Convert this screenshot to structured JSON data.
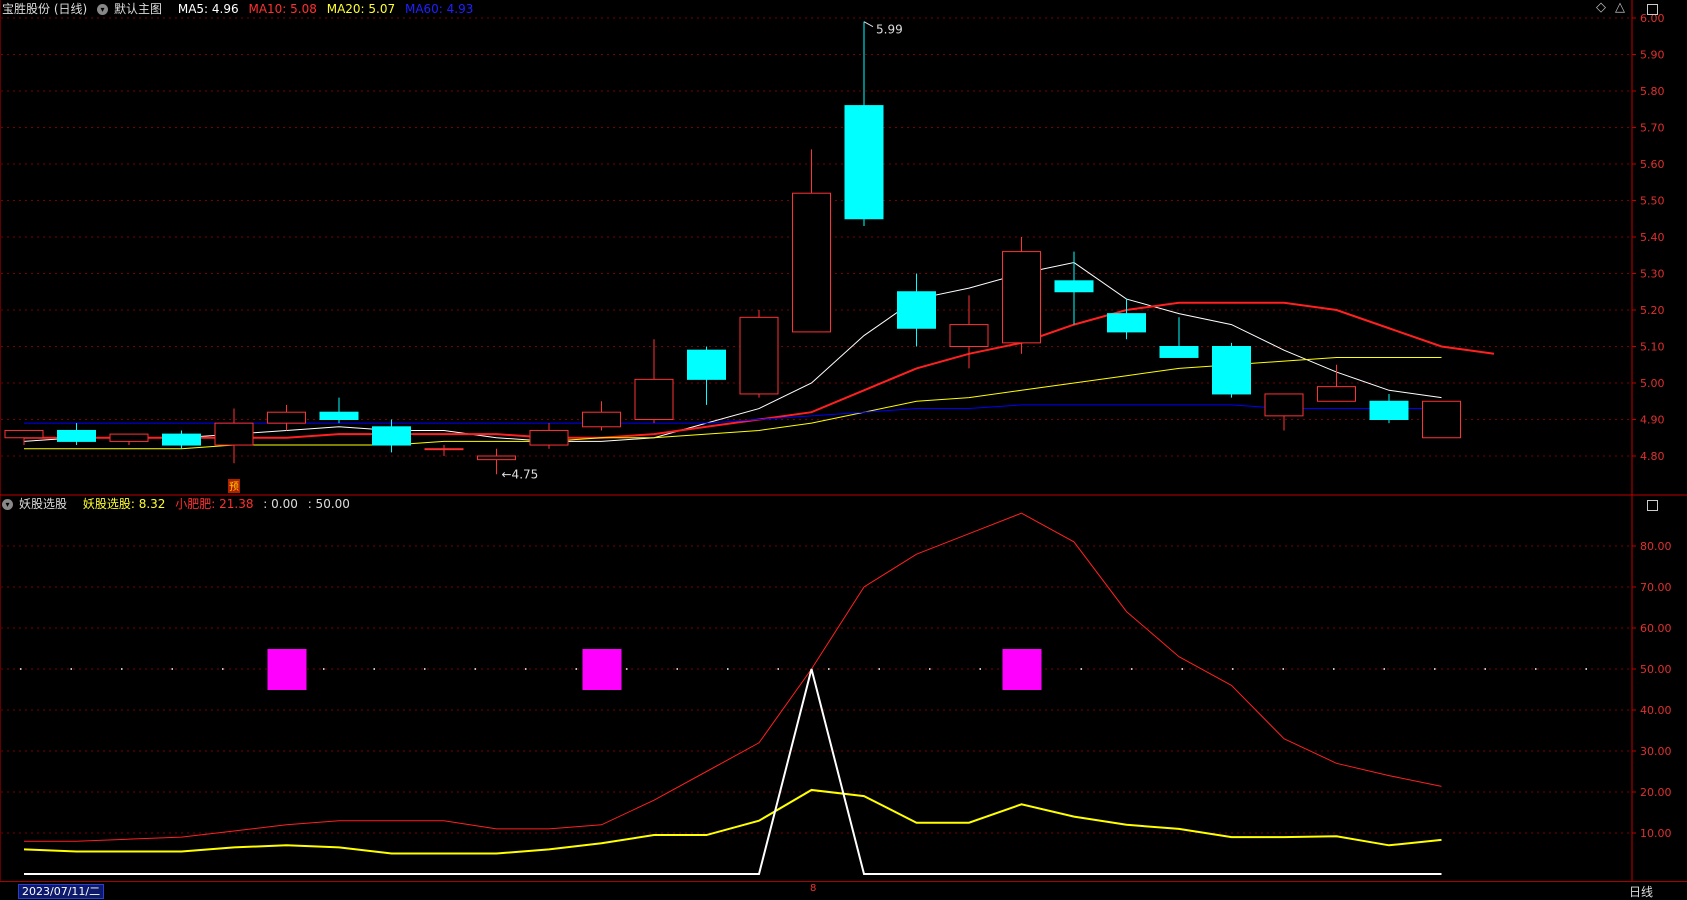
{
  "header": {
    "stock_name": "宝胜股份 (日线)",
    "template": "默认主图",
    "ma5_label": "MA5: 4.96",
    "ma10_label": "MA10: 5.08",
    "ma20_label": "MA20: 5.07",
    "ma60_label": "MA60: 4.93"
  },
  "indicator_header": {
    "name": "妖股选股",
    "yg_label": "妖股选股: 8.32",
    "xfp_label": "小肥肥: 21.38",
    "zero_label": ": 0.00",
    "fifty_label": ": 50.00"
  },
  "footer": {
    "date": "2023/07/11/二",
    "period": "日线",
    "cursor_label": "8"
  },
  "colors": {
    "up": "#ff3232",
    "down": "#00ffff",
    "ma5": "#ffffff",
    "ma10": "#ff2020",
    "ma20": "#ffff00",
    "ma60": "#0000ff",
    "magenta": "#ff00ff",
    "axis": "#c00000"
  },
  "chart_data": [
    {
      "type": "candlestick",
      "title": "宝胜股份 (日线)",
      "y_ticks": [
        "6.00",
        "5.90",
        "5.80",
        "5.70",
        "5.60",
        "5.50",
        "5.40",
        "5.30",
        "5.20",
        "5.10",
        "5.00",
        "4.90",
        "4.80"
      ],
      "ylim": [
        4.75,
        6.0
      ],
      "annotations": [
        {
          "text": "5.99",
          "note": "high"
        },
        {
          "text": "←4.75",
          "note": "low"
        }
      ],
      "marker_text": "预",
      "candles": [
        {
          "o": 4.85,
          "h": 4.87,
          "l": 4.83,
          "c": 4.87
        },
        {
          "o": 4.87,
          "h": 4.89,
          "l": 4.83,
          "c": 4.84
        },
        {
          "o": 4.84,
          "h": 4.86,
          "l": 4.83,
          "c": 4.86
        },
        {
          "o": 4.86,
          "h": 4.87,
          "l": 4.82,
          "c": 4.83
        },
        {
          "o": 4.83,
          "h": 4.93,
          "l": 4.78,
          "c": 4.89
        },
        {
          "o": 4.89,
          "h": 4.94,
          "l": 4.87,
          "c": 4.92
        },
        {
          "o": 4.92,
          "h": 4.96,
          "l": 4.89,
          "c": 4.9
        },
        {
          "o": 4.88,
          "h": 4.9,
          "l": 4.81,
          "c": 4.83
        },
        {
          "o": 4.82,
          "h": 4.83,
          "l": 4.8,
          "c": 4.82
        },
        {
          "o": 4.79,
          "h": 4.82,
          "l": 4.75,
          "c": 4.8
        },
        {
          "o": 4.83,
          "h": 4.89,
          "l": 4.82,
          "c": 4.87
        },
        {
          "o": 4.88,
          "h": 4.95,
          "l": 4.87,
          "c": 4.92
        },
        {
          "o": 4.9,
          "h": 5.12,
          "l": 4.89,
          "c": 5.01
        },
        {
          "o": 5.09,
          "h": 5.1,
          "l": 4.94,
          "c": 5.01
        },
        {
          "o": 4.97,
          "h": 5.2,
          "l": 4.96,
          "c": 5.18
        },
        {
          "o": 5.14,
          "h": 5.64,
          "l": 5.14,
          "c": 5.52
        },
        {
          "o": 5.76,
          "h": 5.99,
          "l": 5.43,
          "c": 5.45
        },
        {
          "o": 5.25,
          "h": 5.3,
          "l": 5.1,
          "c": 5.15
        },
        {
          "o": 5.1,
          "h": 5.24,
          "l": 5.04,
          "c": 5.16
        },
        {
          "o": 5.11,
          "h": 5.4,
          "l": 5.08,
          "c": 5.36
        },
        {
          "o": 5.28,
          "h": 5.36,
          "l": 5.16,
          "c": 5.25
        },
        {
          "o": 5.19,
          "h": 5.23,
          "l": 5.12,
          "c": 5.14
        },
        {
          "o": 5.1,
          "h": 5.18,
          "l": 5.07,
          "c": 5.07
        },
        {
          "o": 5.1,
          "h": 5.11,
          "l": 4.96,
          "c": 4.97
        },
        {
          "o": 4.91,
          "h": 4.97,
          "l": 4.87,
          "c": 4.97
        },
        {
          "o": 4.95,
          "h": 5.05,
          "l": 4.95,
          "c": 4.99
        },
        {
          "o": 4.95,
          "h": 4.97,
          "l": 4.89,
          "c": 4.9
        },
        {
          "o": 4.85,
          "h": 4.95,
          "l": 4.85,
          "c": 4.95
        }
      ],
      "series": [
        {
          "name": "MA5",
          "color": "#ffffff",
          "values": [
            4.84,
            4.85,
            4.85,
            4.85,
            4.86,
            4.87,
            4.88,
            4.87,
            4.87,
            4.85,
            4.84,
            4.84,
            4.85,
            4.89,
            4.93,
            5.0,
            5.13,
            5.23,
            5.26,
            5.3,
            5.33,
            5.23,
            5.19,
            5.16,
            5.09,
            5.03,
            4.98,
            4.96
          ]
        },
        {
          "name": "MA10",
          "color": "#ff2020",
          "values": [
            4.85,
            4.85,
            4.85,
            4.85,
            4.85,
            4.85,
            4.86,
            4.86,
            4.86,
            4.86,
            4.85,
            4.85,
            4.86,
            4.88,
            4.9,
            4.92,
            4.98,
            5.04,
            5.08,
            5.11,
            5.16,
            5.2,
            5.22,
            5.22,
            5.22,
            5.2,
            5.15,
            5.1,
            5.08
          ]
        },
        {
          "name": "MA20",
          "color": "#ffff00",
          "values": [
            4.82,
            4.82,
            4.82,
            4.82,
            4.83,
            4.83,
            4.83,
            4.83,
            4.84,
            4.84,
            4.84,
            4.85,
            4.85,
            4.86,
            4.87,
            4.89,
            4.92,
            4.95,
            4.96,
            4.98,
            5.0,
            5.02,
            5.04,
            5.05,
            5.06,
            5.07,
            5.07,
            5.07
          ]
        },
        {
          "name": "MA60",
          "color": "#0000ff",
          "values": [
            4.89,
            4.89,
            4.89,
            4.89,
            4.89,
            4.89,
            4.89,
            4.89,
            4.89,
            4.89,
            4.89,
            4.89,
            4.89,
            4.89,
            4.9,
            4.91,
            4.92,
            4.93,
            4.93,
            4.94,
            4.94,
            4.94,
            4.94,
            4.94,
            4.93,
            4.93,
            4.93,
            4.93
          ]
        }
      ]
    },
    {
      "type": "line",
      "title": "妖股选股",
      "y_ticks": [
        "80.00",
        "70.00",
        "60.00",
        "50.00",
        "40.00",
        "30.00",
        "20.00",
        "10.00"
      ],
      "ylim": [
        0,
        90
      ],
      "x_index_count": 28,
      "series": [
        {
          "name": "小肥肥",
          "color": "#ff2020",
          "values": [
            8,
            8,
            8.5,
            9,
            10.5,
            12,
            13,
            13,
            13,
            11,
            11,
            12,
            18,
            25,
            32,
            50,
            70,
            78,
            83,
            88,
            81,
            64,
            53,
            46,
            33,
            27,
            24,
            21.38
          ]
        },
        {
          "name": "妖股选股",
          "color": "#ffff00",
          "values": [
            6,
            5.5,
            5.5,
            5.5,
            6.5,
            7,
            6.5,
            5,
            5,
            5,
            6,
            7.5,
            9.5,
            9.5,
            13,
            20.5,
            19,
            12.5,
            12.5,
            17,
            14,
            12,
            11,
            9,
            9,
            9.2,
            7,
            8.32
          ]
        },
        {
          "name": "",
          "color": "#ffffff",
          "values": [
            0,
            0,
            0,
            0,
            0,
            0,
            0,
            0,
            0,
            0,
            0,
            0,
            0,
            0,
            0,
            50,
            0,
            0,
            0,
            0,
            0,
            0,
            0,
            0,
            0,
            0,
            0,
            0
          ]
        }
      ],
      "signal_markers_at_50": [
        5,
        11,
        19
      ],
      "reference_line": 50
    }
  ]
}
